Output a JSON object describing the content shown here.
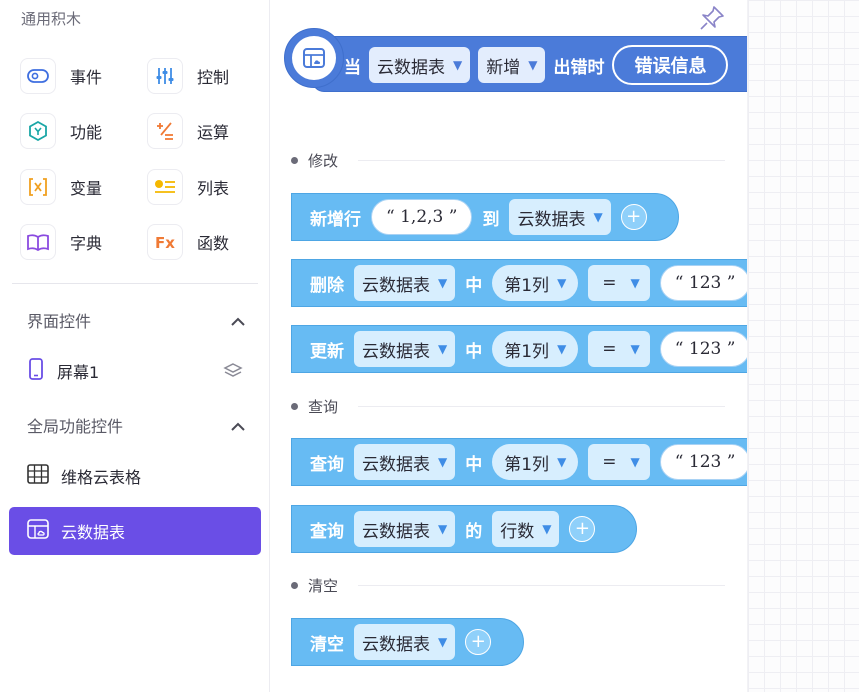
{
  "sidebar": {
    "general_title": "通用积木",
    "tiles": [
      {
        "label": "事件",
        "icon": "event-icon",
        "color": "#3f6fe0"
      },
      {
        "label": "控制",
        "icon": "control-icon",
        "color": "#3f8de6"
      },
      {
        "label": "功能",
        "icon": "function-icon",
        "color": "#1aa6a6"
      },
      {
        "label": "运算",
        "icon": "operation-icon",
        "color": "#f07a35"
      },
      {
        "label": "变量",
        "icon": "variable-icon",
        "color": "#f0a020"
      },
      {
        "label": "列表",
        "icon": "list-icon",
        "color": "#f5b800"
      },
      {
        "label": "字典",
        "icon": "dictionary-icon",
        "color": "#8a4be0"
      },
      {
        "label": "函数",
        "icon": "fx-icon",
        "color": "#f07a35"
      }
    ],
    "ui_controls": {
      "title": "界面控件",
      "items": [
        {
          "label": "屏幕1"
        }
      ]
    },
    "global_controls": {
      "title": "全局功能控件",
      "items": [
        {
          "label": "维格云表格"
        },
        {
          "label": "云数据表"
        }
      ]
    }
  },
  "canvas": {
    "hat": {
      "when": "当",
      "table": "云数据表",
      "action": "新增",
      "suffix": "出错时",
      "param": "错误信息"
    },
    "categories": {
      "modify": "修改",
      "query": "查询",
      "clear": "清空"
    },
    "blocks": {
      "add_row": {
        "label": "新增行",
        "value": "“ 1,2,3 ”",
        "to": "到",
        "table": "云数据表"
      },
      "delete": {
        "label": "删除",
        "table": "云数据表",
        "in": "中",
        "col": "第1列",
        "op": "=",
        "value": "“ 123 ”"
      },
      "update": {
        "label": "更新",
        "table": "云数据表",
        "in": "中",
        "col": "第1列",
        "op": "=",
        "value": "“ 123 ”"
      },
      "query": {
        "label": "查询",
        "table": "云数据表",
        "in": "中",
        "col": "第1列",
        "op": "=",
        "value": "“ 123 ”"
      },
      "query_rows": {
        "label": "查询",
        "table": "云数据表",
        "of": "的",
        "field": "行数"
      },
      "clear": {
        "label": "清空",
        "table": "云数据表"
      }
    }
  },
  "colors": {
    "accent": "#6a4ee6",
    "hat_block": "#4b7bd9",
    "data_block": "#67bbf3"
  }
}
